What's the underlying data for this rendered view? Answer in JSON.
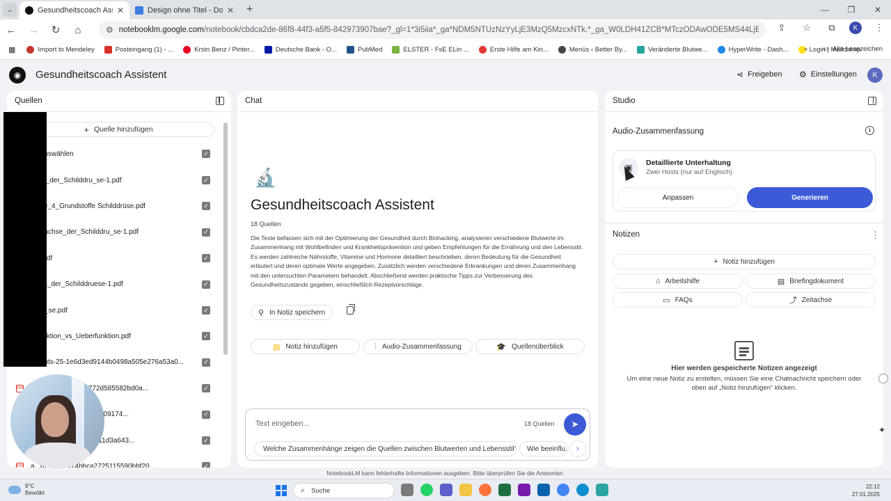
{
  "browser": {
    "tabs": [
      {
        "title": "Gesundheitscoach Assistent",
        "active": true,
        "color": "#111111"
      },
      {
        "title": "Design ohne Titel - Doc",
        "active": false,
        "color": "#3b7de0"
      }
    ],
    "url_host": "notebooklm.google.com",
    "url_path": "/notebook/cbdca2de-86f8-44f3-a5f5-842973907bae?_gl=1*3i5iia*_ga*NDM5NTUzNzYyLjE3MzQ5MzcxNTk.*_ga_W0LDH41ZCB*MTczODAwODE5MS44LjEuMTczODAwODE5MS4wLjAu...",
    "bookmarks": [
      {
        "label": "Import to Mendeley",
        "color": "#c0392b"
      },
      {
        "label": "Posteingang (1) - ...",
        "color": "#d93025"
      },
      {
        "label": "Krstn Benz / Pinter...",
        "color": "#e60023"
      },
      {
        "label": "Deutsche Bank - O...",
        "color": "#0018a8"
      },
      {
        "label": "PubMed",
        "color": "#20558a"
      },
      {
        "label": "ELSTER - FsE ELin ...",
        "color": "#7cb342"
      },
      {
        "label": "Erste Hilfe am Kin...",
        "color": "#e53935"
      },
      {
        "label": "Menüs ‹ Better By...",
        "color": "#464646"
      },
      {
        "label": "Veränderte Blutwe...",
        "color": "#26a69a"
      },
      {
        "label": "HyperWrite - Dash...",
        "color": "#1e88e5"
      },
      {
        "label": "Login | Mailchimp",
        "color": "#ffe01b"
      }
    ],
    "all_bookmarks": "Alle Lesezeichen",
    "more": "»"
  },
  "app": {
    "title": "Gesundheitscoach Assistent",
    "share": "Freigeben",
    "settings": "Einstellungen",
    "avatar": "K",
    "disclaimer": "NotebookLM kann fehlerhafte Informationen ausgeben. Bitte überprüfen Sie die Antworten."
  },
  "sources": {
    "header": "Quellen",
    "add": "Quelle hinzufügen",
    "select_all": "en auswählen",
    "items": [
      "omie_der_Schilddru_se-1.pdf",
      "werte_4_Grundstoffe Schilddrüse.pdf",
      "monachse_der_Schilddru_se-1.pdf",
      "inX.pdf",
      "lation_der_Schilddruese-1.pdf",
      "ddru_se.pdf",
      "erfunktion_vs_Ueberfunktion.pdf",
      "hments-25-1e6d3ed9144b0498a505e276a53a0...",
      "7a6a8ec5e2460d8772d585582bd0a...",
      "2cde54cb3871d8e41e909174...",
      "15a6549948486 7b3a11d3a643...",
      "a...62cf6a2ef74bbca2725115590bbf20..."
    ]
  },
  "chat": {
    "header": "Chat",
    "title": "Gesundheitscoach Assistent",
    "source_count": "18 Quellen",
    "summary": "Die Texte befassen sich mit der Optimierung der Gesundheit durch Biohacking, analysieren verschiedene Blutwerte im Zusammenhang mit Wohlbefinden und Krankheitsprävention und geben Empfehlungen für die Ernährung und den Lebensstil. Es werden zahlreiche Nährstoffe, Vitamine und Hormone detailliert beschrieben, deren Bedeutung für die Gesundheit erläutert und deren optimale Werte angegeben. Zusätzlich werden verschiedene Erkrankungen und deren Zusammenhang mit den untersuchten Parametern behandelt. Abschließend werden praktische Tipps zur Verbesserung des Gesundheitszustands gegeben, einschließlich Rezeptvorschläge.",
    "save_note": "In Notiz speichern",
    "actions": [
      "Notiz hinzufügen",
      "Audio-Zusammenfassung",
      "Quellenüberblick"
    ],
    "input_placeholder": "Text eingeben...",
    "input_count": "18 Quellen",
    "suggestions": [
      "Welche Zusammenhänge zeigen die Quellen zwischen Blutwerten und Lebensstil?",
      "Wie beeinflu..."
    ]
  },
  "studio": {
    "header": "Studio",
    "audio_title": "Audio-Zusammenfassung",
    "card_title": "Detaillierte Unterhaltung",
    "card_subtitle": "Zwei Hosts (nur auf Englisch)",
    "customize": "Anpassen",
    "generate": "Generieren",
    "notes_title": "Notizen",
    "add_note": "Notiz hinzufügen",
    "note_types": [
      "Arbeitshilfe",
      "Briefingdokument",
      "FAQs",
      "Zeitachse"
    ],
    "empty_title": "Hier werden gespeicherte Notizen angezeigt",
    "empty_desc": "Um eine neue Notiz zu erstellen, müssen Sie eine Chatnachricht speichern oder oben auf „Notiz hinzufügen“ klicken."
  },
  "taskbar": {
    "temp": "9°C",
    "weather": "Bewölkt",
    "search": "Suche",
    "time": "22:12",
    "date": "27.01.2025"
  },
  "colors": {
    "accent": "#3c5ad7",
    "checkbox": "#7a7a7a"
  }
}
